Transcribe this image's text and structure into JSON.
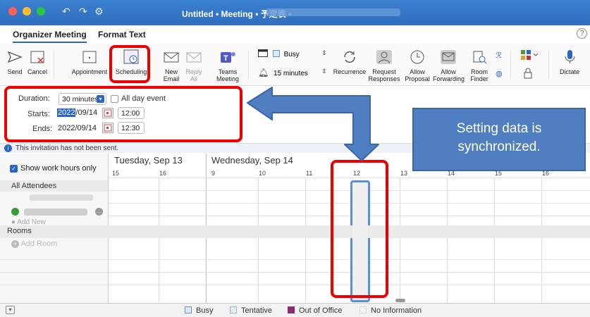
{
  "window": {
    "title": "Untitled • Meeting • 予定表 •"
  },
  "tabs": [
    {
      "label": "Organizer Meeting"
    },
    {
      "label": "Format Text"
    }
  ],
  "ribbon": {
    "send": "Send",
    "cancel": "Cancel",
    "appointment": "Appointment",
    "scheduling": "Scheduling",
    "new_email": "New\nEmail",
    "reply_all": "Reply\nAll",
    "teams_meeting": "Teams\nMeeting",
    "show_as": "Busy",
    "reminder": "15 minutes",
    "recurrence": "Recurrence",
    "request_responses": "Request\nResponses",
    "allow_proposal": "Allow\nProposal",
    "allow_forwarding": "Allow\nForwarding",
    "room_finder": "Room\nFinder",
    "dictate": "Dictate"
  },
  "options": {
    "duration_label": "Duration:",
    "duration_value": "30 minutes",
    "all_day_label": "All day event",
    "starts_label": "Starts:",
    "start_year": "2022",
    "start_date_rest": "/09/14",
    "start_time": "12:00",
    "ends_label": "Ends:",
    "end_date": "2022/09/14",
    "end_time": "12:30"
  },
  "notice": "This invitation has not been sent.",
  "callout": "Setting data is synchronized.",
  "schedule": {
    "show_work_hours": "Show work hours only",
    "all_attendees": "All Attendees",
    "add_new": "Add New",
    "rooms": "Rooms",
    "add_room": "Add Room",
    "days": [
      "Tuesday, Sep 13",
      "Wednesday, Sep 14"
    ],
    "hours": [
      "15",
      "16",
      "9",
      "10",
      "11",
      "12",
      "13",
      "14",
      "15",
      "16"
    ]
  },
  "legend": {
    "busy": "Busy",
    "tentative": "Tentative",
    "out_of_office": "Out of Office",
    "no_information": "No Information"
  },
  "colors": {
    "accent": "#2b66c5",
    "highlight": "#e00000",
    "callout": "#4f7fc0",
    "out_of_office": "#8e2a6e"
  }
}
